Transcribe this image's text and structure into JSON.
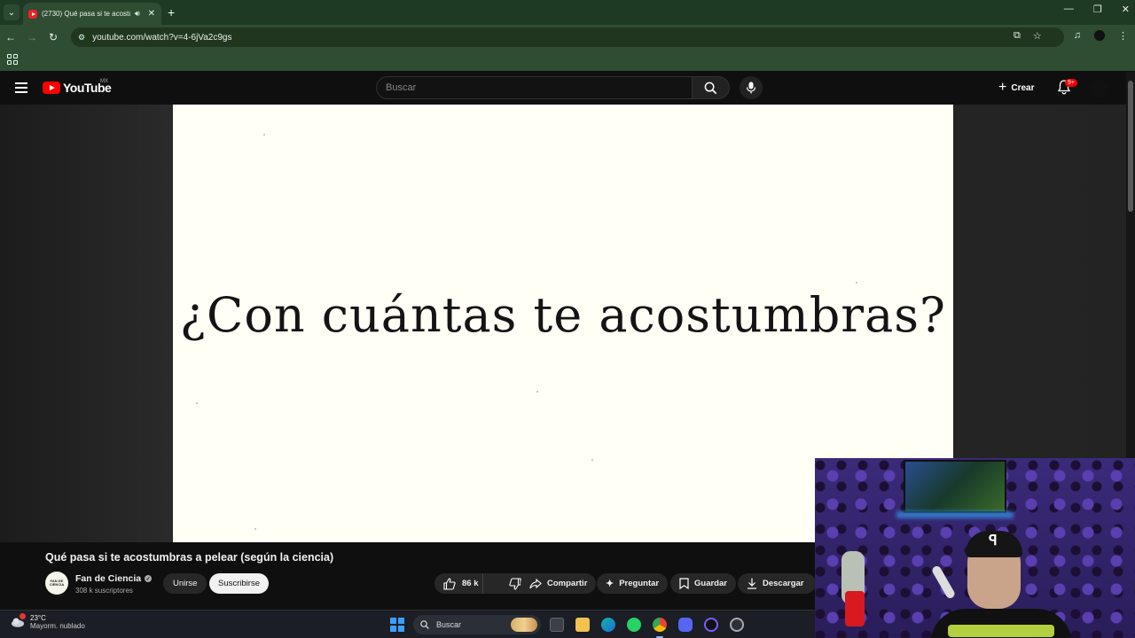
{
  "browser": {
    "tab_title": "(2730) Qué pasa si te acostu",
    "tab_audio_icon": "speaker-icon",
    "url": "youtube.com/watch?v=4-6jVa2c9gs"
  },
  "youtube": {
    "logo_text": "YouTube",
    "region": "MX",
    "search_placeholder": "Buscar",
    "create_label": "Crear",
    "notif_badge": "9+"
  },
  "video": {
    "frame_text": "¿Con cuántas te acostumbras?",
    "title": "Qué pasa si te acostumbras a pelear (según la ciencia)",
    "channel": {
      "name": "Fan de Ciencia",
      "avatar_text": "FAN DE CIENCIA",
      "subscribers": "308 k suscriptores",
      "join_label": "Unirse",
      "subscribe_label": "Suscribirse"
    },
    "actions": {
      "likes": "86 k",
      "share": "Compartir",
      "ask": "Preguntar",
      "save": "Guardar",
      "download": "Descargar"
    }
  },
  "taskbar": {
    "temperature": "23°C",
    "condition": "Mayorm. nublado",
    "search_label": "Buscar"
  },
  "colors": {
    "chrome_frame": "#1f3a24",
    "chrome_toolbar": "#2e4d33",
    "youtube_bg": "#0f0f0f",
    "youtube_red": "#ff0000",
    "video_paper": "#fffff6"
  }
}
